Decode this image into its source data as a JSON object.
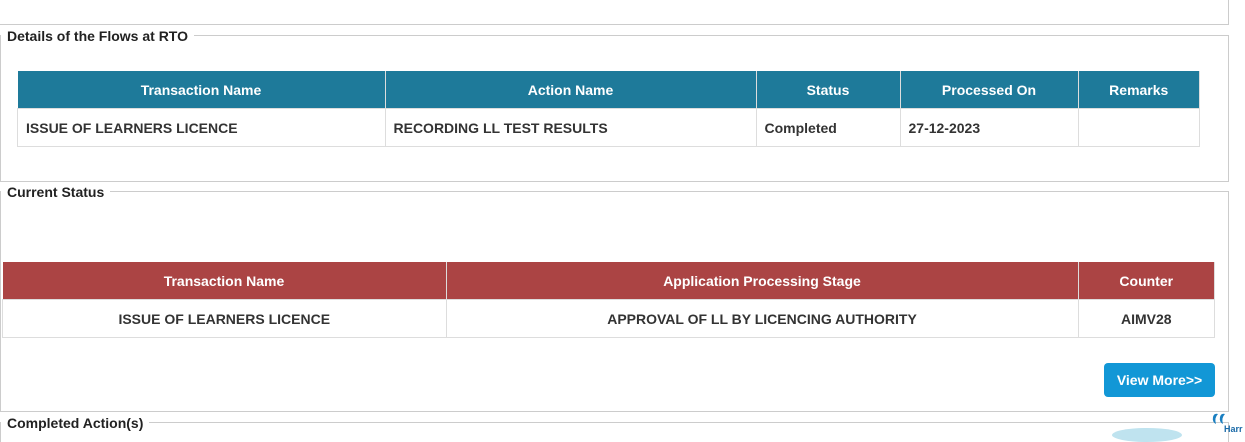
{
  "flows": {
    "legend": "Details of the Flows at RTO",
    "columns": [
      "Transaction Name",
      "Action Name",
      "Status",
      "Processed On",
      "Remarks"
    ],
    "rows": [
      [
        "ISSUE OF LEARNERS LICENCE",
        "RECORDING LL TEST RESULTS",
        "Completed",
        "27-12-2023",
        ""
      ]
    ]
  },
  "current_status": {
    "legend": "Current Status",
    "columns": [
      "Transaction Name",
      "Application Processing Stage",
      "Counter"
    ],
    "rows": [
      [
        "ISSUE OF LEARNERS LICENCE",
        "APPROVAL OF LL BY LICENCING AUTHORITY",
        "AIMV28"
      ]
    ],
    "view_more_label": "View More>>"
  },
  "completed": {
    "legend": "Completed Action(s)"
  },
  "widget": {
    "icon": "help-chat-icon",
    "text": "Harr"
  },
  "colors": {
    "flows_header": "#1e7a9a",
    "status_header": "#ab4444",
    "button": "#1297d6"
  }
}
